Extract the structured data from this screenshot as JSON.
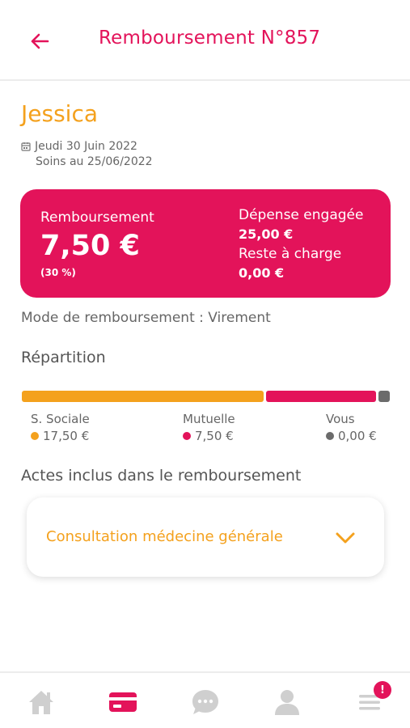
{
  "header": {
    "title": "Remboursement N°857"
  },
  "patient": {
    "name": "Jessica",
    "date": "Jeudi 30 Juin 2022",
    "soins": "Soins au 25/06/2022"
  },
  "card": {
    "reimbursement_label": "Remboursement",
    "reimbursement_amount": "7,50 €",
    "percent": "(30 %)",
    "expense_label": "Dépense engagée",
    "expense_amount": "25,00 €",
    "remaining_label": "Reste à charge",
    "remaining_amount": "0,00 €"
  },
  "mode": "Mode de remboursement : Virement",
  "repartition": {
    "title": "Répartition",
    "items": [
      {
        "label": "S. Sociale",
        "value": "17,50 €",
        "color": "#f4a11d"
      },
      {
        "label": "Mutuelle",
        "value": "7,50 €",
        "color": "#e3135a"
      },
      {
        "label": "Vous",
        "value": "0,00 €",
        "color": "#6b6b6b"
      }
    ]
  },
  "actes": {
    "title": "Actes inclus dans le remboursement",
    "items": [
      {
        "label": "Consultation médecine générale"
      }
    ]
  },
  "nav": {
    "items": [
      {
        "icon": "home-icon",
        "active": false
      },
      {
        "icon": "card-icon",
        "active": true
      },
      {
        "icon": "chat-icon",
        "active": false
      },
      {
        "icon": "user-icon",
        "active": false
      },
      {
        "icon": "menu-icon",
        "active": false
      }
    ],
    "badge": "!"
  },
  "colors": {
    "primary": "#e3135a",
    "accent": "#f4a11d",
    "neutral": "#6b6b6b"
  }
}
